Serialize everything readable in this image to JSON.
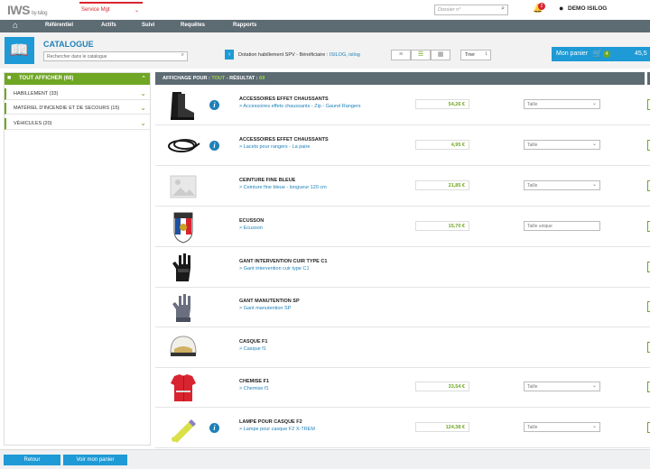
{
  "app": {
    "logo": "IWS",
    "logo_by": "by isilog"
  },
  "header": {
    "service": "Service Mgt",
    "dossier_placeholder": "Dossier n°",
    "notif_count": "2",
    "user": "DEMO ISILOG"
  },
  "nav": [
    "Référentiel",
    "Actifs",
    "Suivi",
    "Requêtes",
    "Rapports"
  ],
  "catalogue": {
    "title": "CATALOGUE",
    "search_placeholder": "Rechercher dans le catalogue",
    "dotation_prefix": "Dotation habillement SPV - Bénéficiaire : ",
    "dotation_beneficiary": "ISILOG, isilog",
    "sort_label": "Trier",
    "cart_label": "Mon panier",
    "cart_qty": "4",
    "cart_amount": "45,5"
  },
  "sidebar": {
    "all_label": "TOUT AFFICHER (68)",
    "items": [
      "HABILLEMENT (33)",
      "MATÉRIEL D'INCENDIE ET DE SECOURS (15)",
      "VÉHICULES (20)"
    ]
  },
  "results": {
    "prefix": "AFFICHAGE POUR : ",
    "filter": "TOUT",
    "separator": " - RÉSULTAT : ",
    "count": "69"
  },
  "products": [
    {
      "name": "ACCESSOIRES EFFET CHAUSSANTS",
      "sub": "> Accessoires effets chaussants - Zip - Gaurel Rangers",
      "price": "54,26 €",
      "size": "Taille",
      "size_type": "select",
      "info": true,
      "thumb": "boots"
    },
    {
      "name": "ACCESSOIRES EFFET CHAUSSANTS",
      "sub": "> Lacets pour rangers - La paire",
      "price": "4,95 €",
      "size": "Taille",
      "size_type": "select",
      "info": true,
      "thumb": "laces"
    },
    {
      "name": "CEINTURE FINE BLEUE",
      "sub": "> Ceinture fine bleue - longueur 120 cm",
      "price": "21,85 €",
      "size": "Taille",
      "size_type": "select",
      "info": false,
      "thumb": "placeholder"
    },
    {
      "name": "ECUSSON",
      "sub": "> Ecusson",
      "price": "15,70 €",
      "size": "Taille unique",
      "size_type": "input",
      "info": false,
      "thumb": "badge"
    },
    {
      "name": "GANT INTERVENTION CUIR TYPE C1",
      "sub": "> Gant intervention cuir type C1",
      "price": "",
      "size": "",
      "size_type": "none",
      "info": false,
      "thumb": "glove-black"
    },
    {
      "name": "GANT MANUTENTION SP",
      "sub": "> Gant manutention SP",
      "price": "",
      "size": "",
      "size_type": "none",
      "info": false,
      "thumb": "glove-grey"
    },
    {
      "name": "CASQUE F1",
      "sub": "> Casque f1",
      "price": "",
      "size": "",
      "size_type": "none",
      "info": false,
      "thumb": "helmet"
    },
    {
      "name": "CHEMISE F1",
      "sub": "> Chemise f1",
      "price": "33,54 €",
      "size": "Taille",
      "size_type": "select",
      "info": false,
      "thumb": "shirt"
    },
    {
      "name": "LAMPE POUR CASQUE F2",
      "sub": "> Lampe pour casque F2 X-TREM",
      "price": "124,38 €",
      "size": "Taille",
      "size_type": "select",
      "info": true,
      "thumb": "lamp"
    }
  ],
  "footer": {
    "back": "Retour",
    "view_cart": "Voir mon panier"
  },
  "colors": {
    "accent_blue": "#1e9ad6",
    "accent_green": "#6fa623",
    "brand_red": "#d9242f",
    "nav_grey": "#5d6b73"
  }
}
